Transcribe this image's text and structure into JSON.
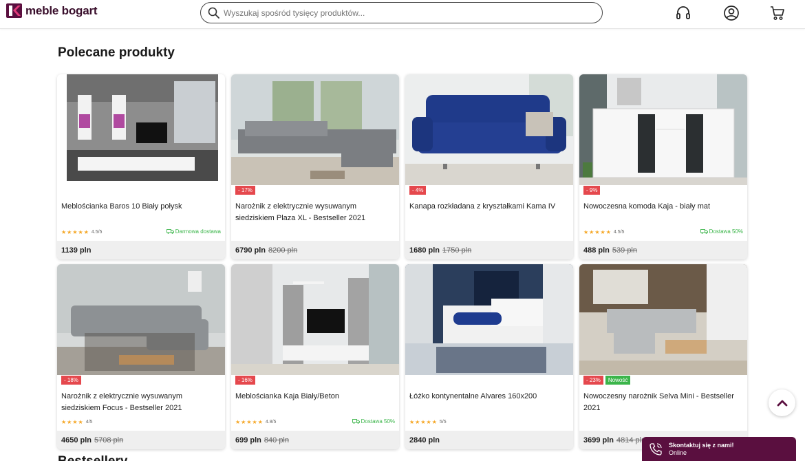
{
  "header": {
    "logo_text": "meble bogart",
    "search_placeholder": "Wyszukaj spośród tysięcy produktów..."
  },
  "section_title": "Polecane produkty",
  "next_section_title": "Bestsellery",
  "products": [
    {
      "name": "Meblościanka Baros 10 Biały połysk",
      "rating": "4.5/5",
      "delivery": "Darmowa dostawa",
      "price": "1139 pln",
      "old_price": "",
      "discount": "",
      "new": ""
    },
    {
      "name": "Narożnik z elektrycznie wysuwanym siedziskiem Plaza XL - Bestseller 2021",
      "rating": "",
      "delivery": "",
      "price": "6790 pln",
      "old_price": "8200 pln",
      "discount": "- 17%",
      "new": ""
    },
    {
      "name": "Kanapa rozkładana z kryształkami Kama IV",
      "rating": "",
      "delivery": "",
      "price": "1680 pln",
      "old_price": "1750 pln",
      "discount": "- 4%",
      "new": ""
    },
    {
      "name": "Nowoczesna komoda Kaja - biały mat",
      "rating": "4.5/5",
      "delivery": "Dostawa 50%",
      "price": "488 pln",
      "old_price": "539 pln",
      "discount": "- 9%",
      "new": ""
    },
    {
      "name": "Narożnik z elektrycznie wysuwanym siedziskiem Focus - Bestseller 2021",
      "rating": "4/5",
      "delivery": "",
      "price": "4650 pln",
      "old_price": "5708 pln",
      "discount": "- 18%",
      "new": ""
    },
    {
      "name": "Meblościanka Kaja Biały/Beton",
      "rating": "4.8/5",
      "delivery": "Dostawa 50%",
      "price": "699 pln",
      "old_price": "840 pln",
      "discount": "- 16%",
      "new": ""
    },
    {
      "name": "Łóżko kontynentalne Alvares 160x200",
      "rating": "5/5",
      "delivery": "",
      "price": "2840 pln",
      "old_price": "",
      "discount": "",
      "new": ""
    },
    {
      "name": "Nowoczesny narożnik Selva Mini - Bestseller 2021",
      "rating": "",
      "delivery": "",
      "price": "3699 pln",
      "old_price": "4814 pln",
      "discount": "- 23%",
      "new": "Nowość"
    }
  ],
  "contact": {
    "title": "Skontaktuj się z nami!",
    "status": "Online"
  },
  "colors": {
    "brand": "#5a0f3f",
    "discount": "#e5484d",
    "new": "#3bb54a",
    "stars": "#f5a623"
  }
}
